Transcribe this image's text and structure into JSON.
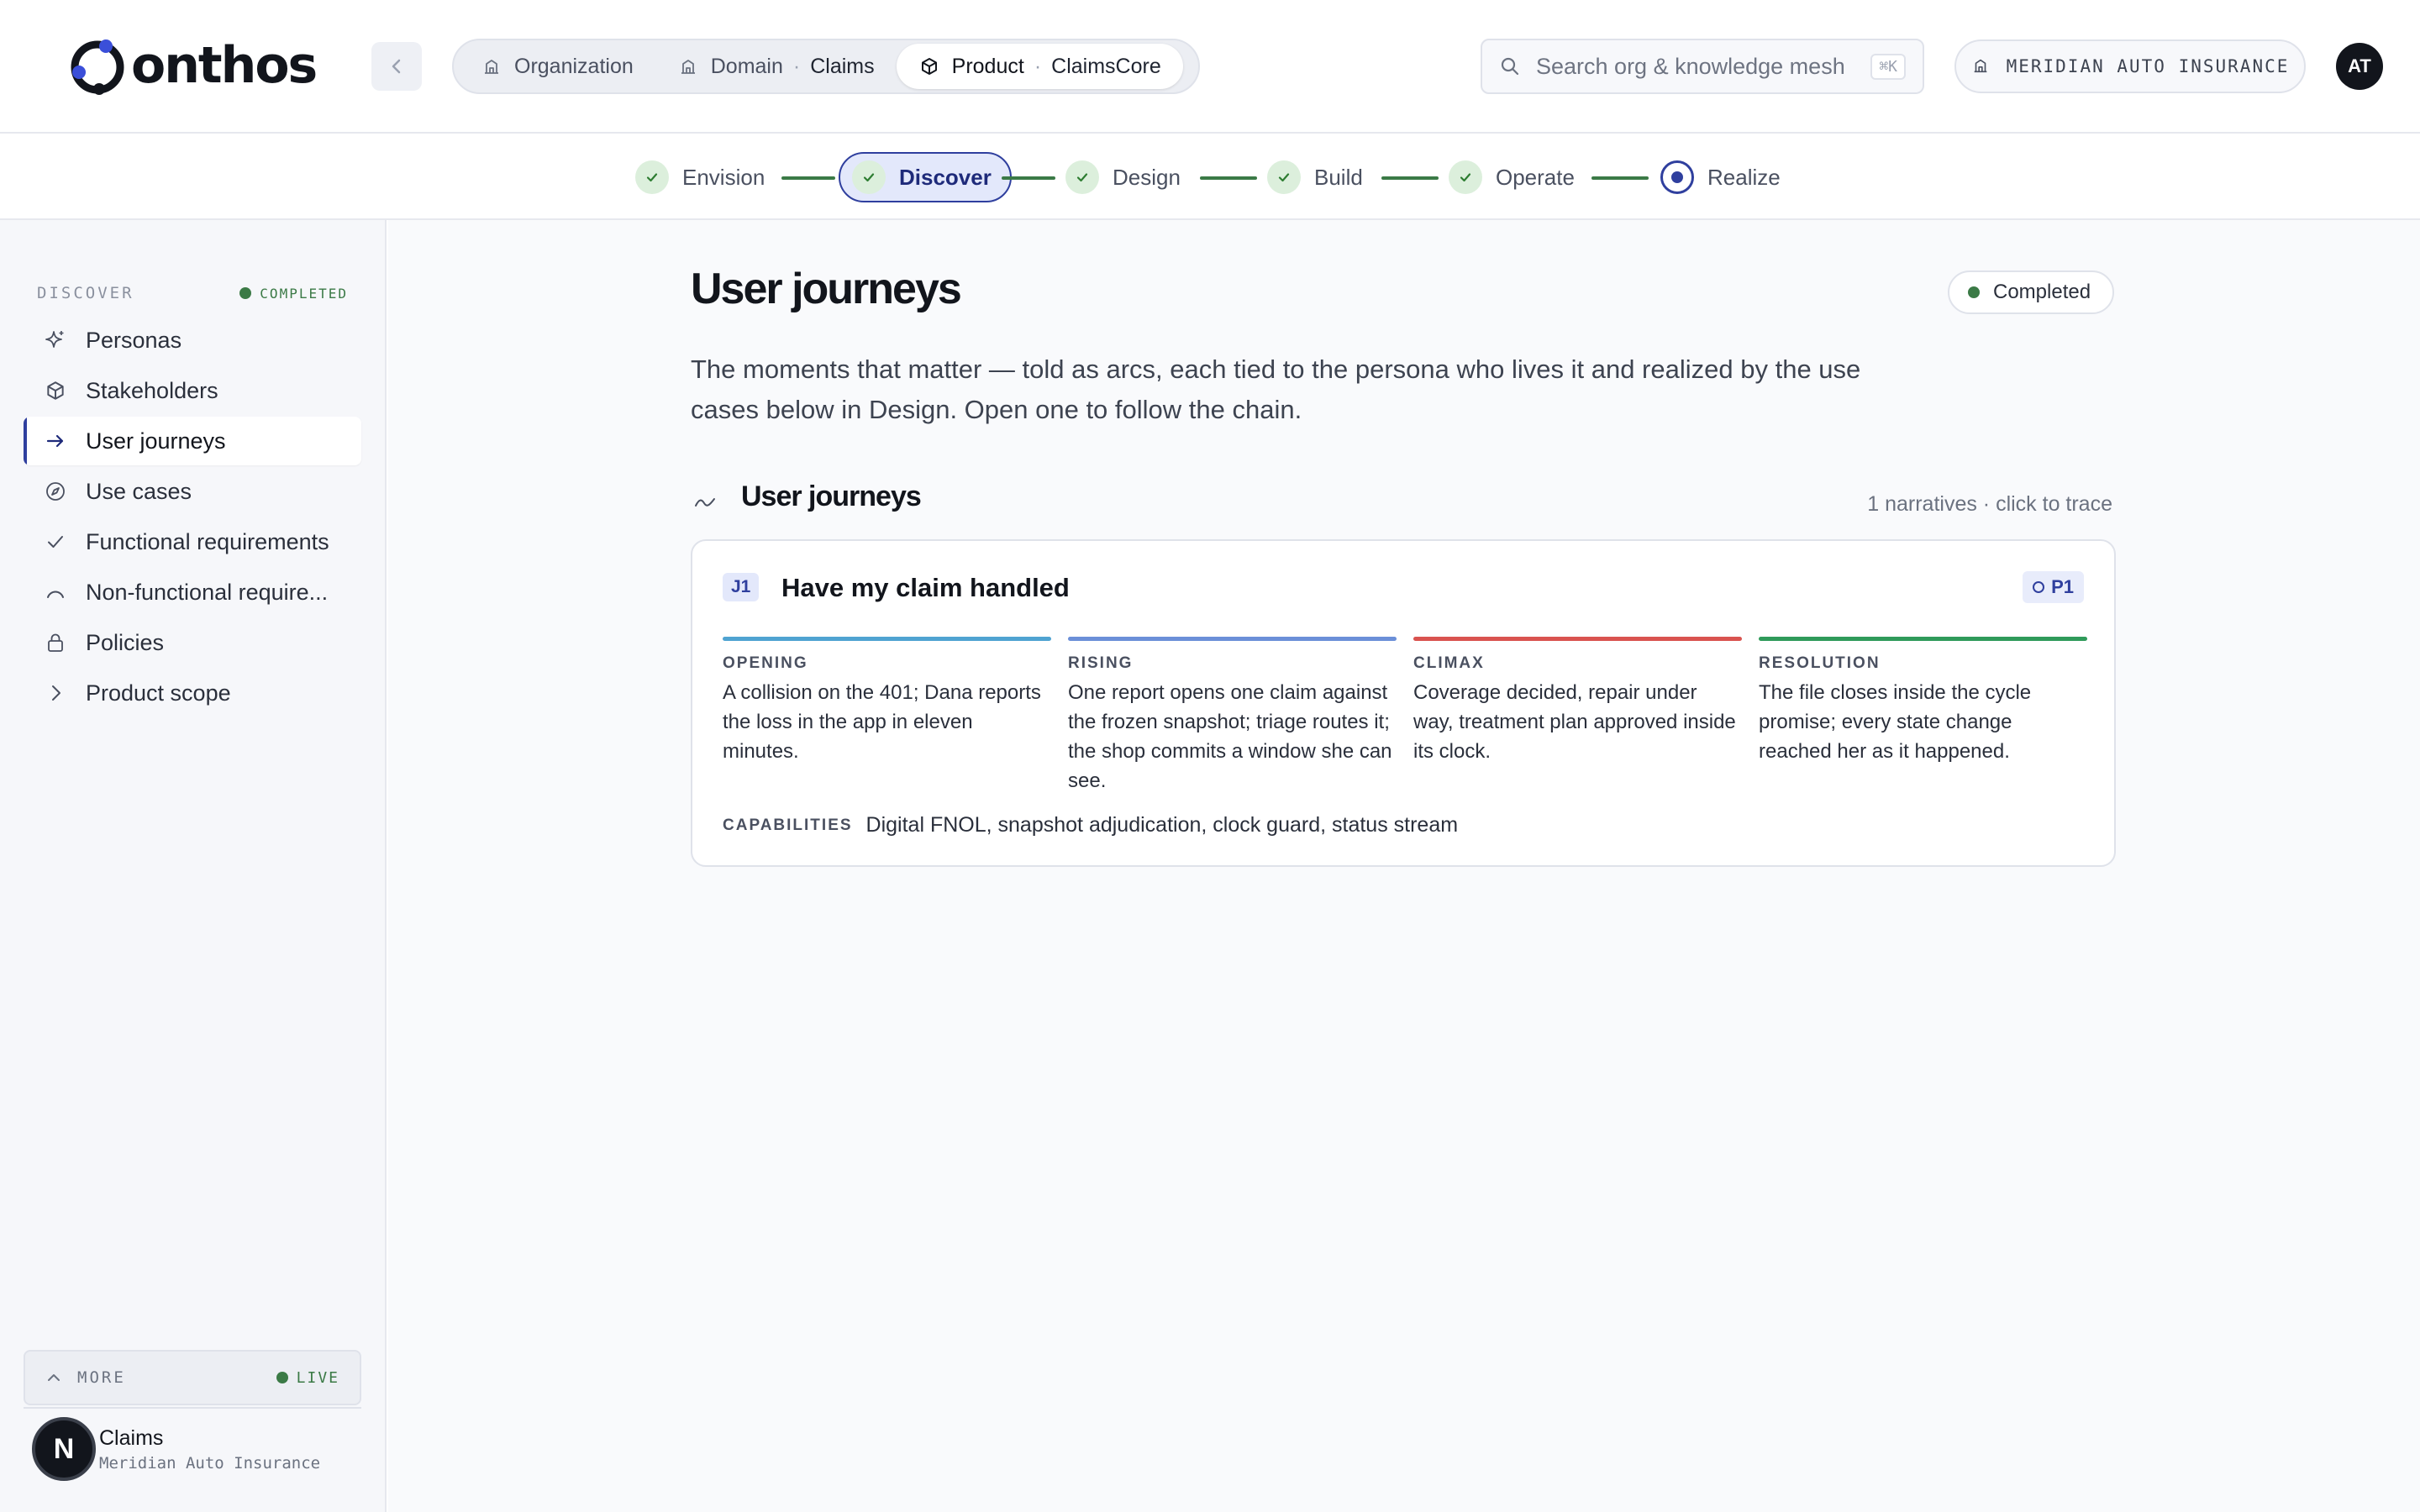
{
  "app": {
    "name": "onthos"
  },
  "scope": {
    "organization": "Organization",
    "domain_label": "Domain",
    "domain_value": "Claims",
    "product_label": "Product",
    "product_value": "ClaimsCore",
    "separator": "·"
  },
  "search": {
    "placeholder": "Search org & knowledge mesh",
    "shortcut": "⌘K"
  },
  "org": {
    "name": "MERIDIAN AUTO INSURANCE"
  },
  "user": {
    "initials": "AT"
  },
  "stepper": {
    "steps": [
      {
        "label": "Envision",
        "state": "done"
      },
      {
        "label": "Discover",
        "state": "active"
      },
      {
        "label": "Design",
        "state": "done"
      },
      {
        "label": "Build",
        "state": "done"
      },
      {
        "label": "Operate",
        "state": "done"
      },
      {
        "label": "Realize",
        "state": "current"
      }
    ]
  },
  "sidebar": {
    "title": "DISCOVER",
    "status": "COMPLETED",
    "items": [
      {
        "label": "Personas",
        "icon": "sparkle-icon"
      },
      {
        "label": "Stakeholders",
        "icon": "cube-icon"
      },
      {
        "label": "User journeys",
        "icon": "arrow-right-icon",
        "active": true
      },
      {
        "label": "Use cases",
        "icon": "compass-icon"
      },
      {
        "label": "Functional requirements",
        "icon": "check-icon"
      },
      {
        "label": "Non-functional require...",
        "icon": "gauge-icon"
      },
      {
        "label": "Policies",
        "icon": "lock-icon"
      },
      {
        "label": "Product scope",
        "icon": "chevron-right-icon"
      }
    ],
    "more_label": "MORE",
    "live_label": "LIVE",
    "workspace": {
      "logo": "N",
      "name": "Claims",
      "org": "Meridian Auto Insurance"
    }
  },
  "main": {
    "title": "User journeys",
    "status_badge": "Completed",
    "intro": "The moments that matter — told as arcs, each tied to the persona who lives it and realized by the use cases below in Design. Open one to follow the chain.",
    "section": {
      "title": "User journeys",
      "meta": "1 narratives · click to trace"
    },
    "journeys": [
      {
        "id": "J1",
        "title": "Have my claim handled",
        "priority": "P1",
        "arcs": [
          {
            "label": "OPENING",
            "color": "#4fa3d1",
            "text": "A collision on the 401; Dana reports the loss in the app in eleven minutes."
          },
          {
            "label": "RISING",
            "color": "#6b8fd8",
            "text": "One report opens one claim against the frozen snapshot; triage routes it; the shop commits a window she can see."
          },
          {
            "label": "CLIMAX",
            "color": "#d9534f",
            "text": "Coverage decided, repair under way, treatment plan approved inside its clock."
          },
          {
            "label": "RESOLUTION",
            "color": "#2f9a5a",
            "text": "The file closes inside the cycle promise; every state change reached her as it happened."
          }
        ],
        "capabilities_label": "CAPABILITIES",
        "capabilities": "Digital FNOL, snapshot adjudication, clock guard, status stream"
      }
    ]
  }
}
